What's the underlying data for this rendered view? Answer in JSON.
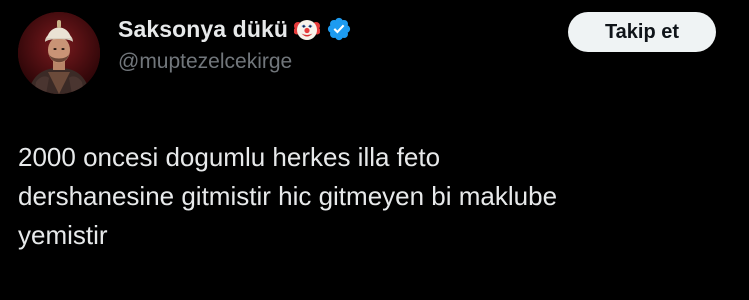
{
  "author": {
    "display_name": "Saksonya dükü",
    "handle": "@muptezelcekirge",
    "name_emoji": "clown-face-icon",
    "verified": true,
    "verified_color": "#1d9bf0"
  },
  "follow_button": {
    "label": "Takip et"
  },
  "tweet": {
    "lines": [
      "2000 oncesi dogumlu herkes illa feto",
      "dershanesine gitmistir hic gitmeyen bi maklube",
      "yemistir"
    ]
  },
  "colors": {
    "background": "#000000",
    "text_primary": "#e7e9ea",
    "text_secondary": "#71767b",
    "button_bg": "#eff3f4",
    "button_text": "#0f1419"
  }
}
